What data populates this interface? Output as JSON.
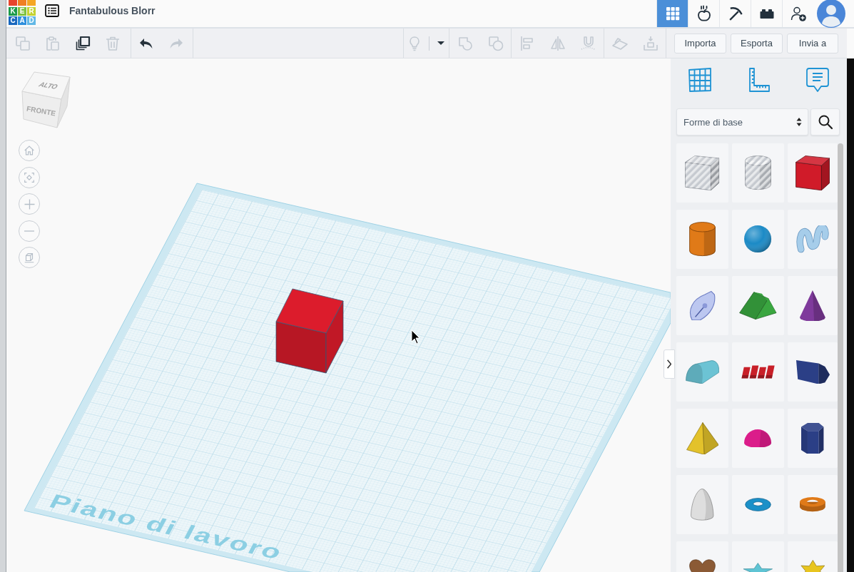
{
  "top_bar": {
    "logo": {
      "tiles": [
        {
          "color": "#e8452e"
        },
        {
          "color": "#f07f22"
        },
        {
          "color": "#f5a623"
        },
        {
          "letter": "K",
          "color": "#1c9b4b"
        },
        {
          "letter": "E",
          "color": "#7fc241"
        },
        {
          "letter": "R",
          "color": "#c4d233"
        },
        {
          "letter": "C",
          "color": "#1867be"
        },
        {
          "letter": "A",
          "color": "#2f8fdd"
        },
        {
          "letter": "D",
          "color": "#62b8e6"
        }
      ]
    },
    "title": "Fantabulous Blorr",
    "apps": [
      {
        "kind": "grid",
        "selected": true
      },
      {
        "kind": "apple",
        "selected": false
      },
      {
        "kind": "pickaxe",
        "selected": false
      },
      {
        "kind": "brick",
        "selected": false
      },
      {
        "kind": "add-user",
        "selected": false
      }
    ]
  },
  "toolbar": {
    "left_groups": [
      [
        {
          "kind": "copy",
          "disabled": true
        },
        {
          "kind": "paste",
          "disabled": true
        },
        {
          "kind": "duplicate",
          "disabled": false
        },
        {
          "kind": "delete",
          "disabled": true
        }
      ],
      [
        {
          "kind": "undo",
          "disabled": false
        },
        {
          "kind": "redo",
          "disabled": true
        }
      ]
    ],
    "right_groups": [
      [
        {
          "kind": "lightbulb",
          "disabled": true
        },
        {
          "kind": "menu-caret",
          "disabled": false
        }
      ],
      [
        {
          "kind": "group",
          "disabled": true
        },
        {
          "kind": "ungroup",
          "disabled": true
        }
      ],
      [
        {
          "kind": "align",
          "disabled": true
        },
        {
          "kind": "mirror",
          "disabled": true
        },
        {
          "kind": "magnet",
          "disabled": true
        }
      ],
      [
        {
          "kind": "workplane",
          "disabled": true
        },
        {
          "kind": "drop",
          "disabled": true
        }
      ]
    ],
    "buttons": [
      "Importa",
      "Esporta",
      "Invia a"
    ]
  },
  "viewport": {
    "view_cube": {
      "top": "ALTO",
      "front": "FRONTE"
    },
    "view_controls": [
      {
        "kind": "home"
      },
      {
        "kind": "fit"
      },
      {
        "kind": "zoom-in"
      },
      {
        "kind": "zoom-out"
      },
      {
        "kind": "projection"
      }
    ],
    "workplane": {
      "label": "Piano di lavoro"
    },
    "objects": [
      {
        "kind": "box",
        "color": "#dc1c2c"
      }
    ]
  },
  "side_panel": {
    "tools": [
      {
        "kind": "grid"
      },
      {
        "kind": "ruler"
      },
      {
        "kind": "notes"
      }
    ],
    "category": {
      "value": "Forme di base"
    },
    "shapes": [
      {
        "kind": "box-hole",
        "color": "#c6cad0"
      },
      {
        "kind": "cylinder-hole",
        "color": "#c6cad0"
      },
      {
        "kind": "box",
        "color": "#d01b29"
      },
      {
        "kind": "cylinder",
        "color": "#e07a18"
      },
      {
        "kind": "sphere",
        "color": "#1b8ac6"
      },
      {
        "kind": "squiggle",
        "color": "#a6cdea"
      },
      {
        "kind": "leaf",
        "color": "#bcc7f0"
      },
      {
        "kind": "roof",
        "color": "#3aa640"
      },
      {
        "kind": "cone",
        "color": "#7f3a9c"
      },
      {
        "kind": "round-roof",
        "color": "#6cc3d4"
      },
      {
        "kind": "text",
        "color": "#c81f28"
      },
      {
        "kind": "pentagon-prism",
        "color": "#2b3f86"
      },
      {
        "kind": "pyramid",
        "color": "#e3c22b"
      },
      {
        "kind": "half-sphere",
        "color": "#db1d8a"
      },
      {
        "kind": "hex-prism",
        "color": "#2b3f86"
      },
      {
        "kind": "paraboloid",
        "color": "#dedede"
      },
      {
        "kind": "torus",
        "color": "#1b90c8"
      },
      {
        "kind": "tube",
        "color": "#e07a18"
      },
      {
        "kind": "heart",
        "color": "#8b5a35"
      },
      {
        "kind": "star",
        "color": "#5fc4d4"
      },
      {
        "kind": "star-six",
        "color": "#e8c51f"
      }
    ]
  }
}
